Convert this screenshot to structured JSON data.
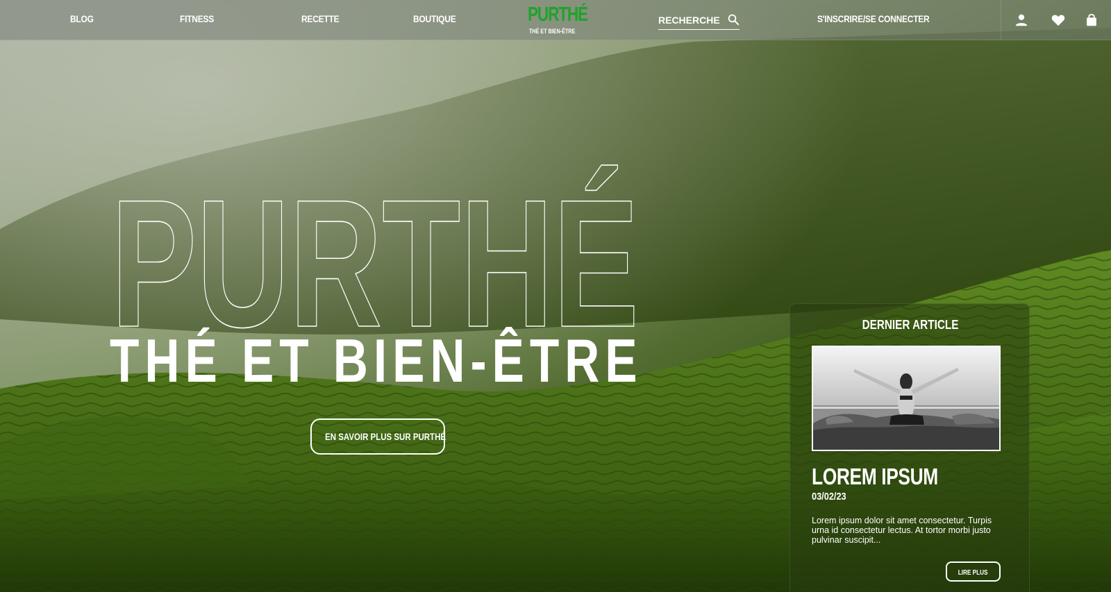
{
  "colors": {
    "brand_green": "#1fa32b",
    "text": "#ffffff",
    "hillside": "#4a6b1c"
  },
  "nav": {
    "links": [
      "BLOG",
      "FITNESS",
      "RECETTE",
      "BOUTIQUE"
    ],
    "logo": {
      "name": "PURTHÉ",
      "tagline": "THÉ ET BIEN-ÊTRE"
    },
    "search": {
      "placeholder": "RECHERCHE",
      "icon": "search-icon"
    },
    "auth_label": "S'INSCRIRE/SE CONNECTER",
    "icons": [
      "user-icon",
      "heart-icon",
      "shopping-bag-icon"
    ]
  },
  "hero": {
    "title": "PURTHÉ",
    "subtitle": "THÉ ET BIEN-ÊTRE",
    "cta_label": "EN SAVOIR PLUS SUR PURTHÉ"
  },
  "latest_article": {
    "heading": "DERNIER ARTICLE",
    "image": "woman-meditating-by-sea-photo",
    "title": "LOREM IPSUM",
    "date": "03/02/23",
    "excerpt": "Lorem ipsum dolor sit amet consectetur. Turpis urna id consectetur lectus. At tortor morbi justo pulvinar suscipit...",
    "read_more_label": "LIRE PLUS"
  }
}
